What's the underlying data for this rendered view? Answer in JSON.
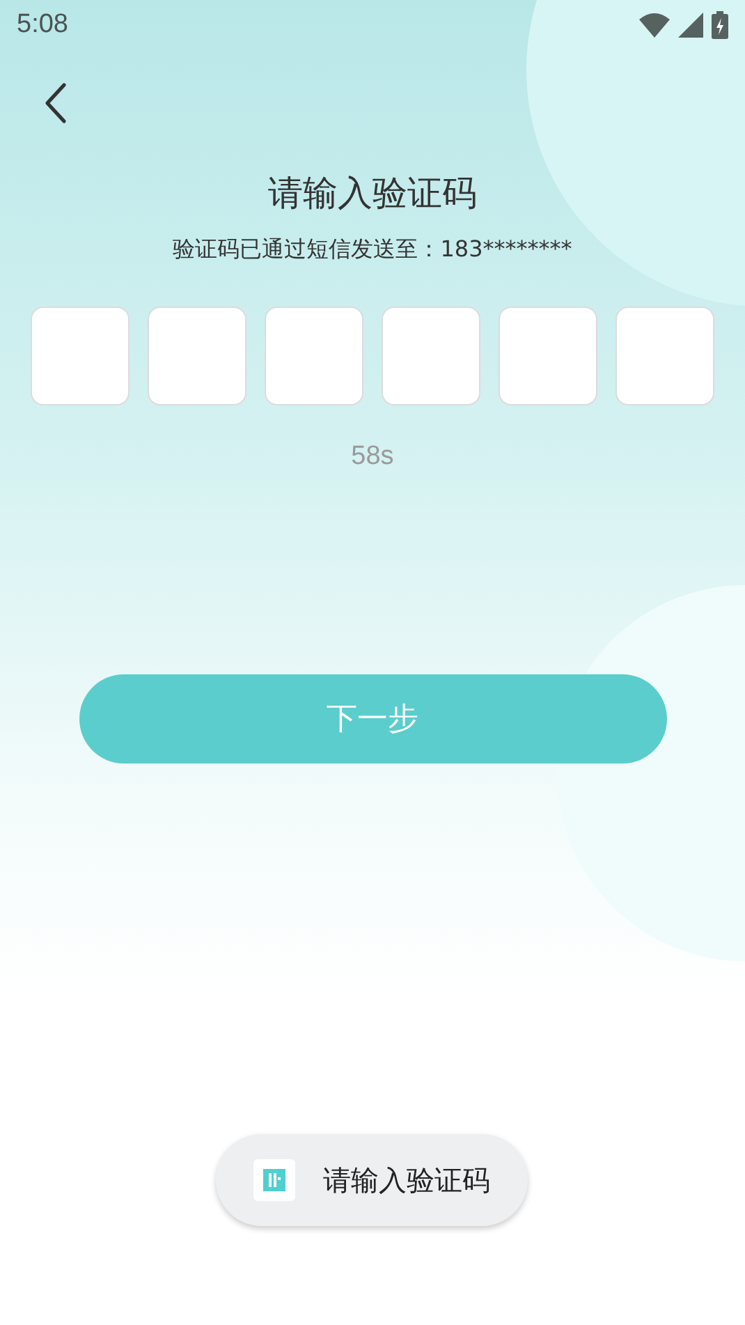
{
  "status_bar": {
    "time": "5:08"
  },
  "title": "请输入验证码",
  "subtitle": "验证码已通过短信发送至：183********",
  "code_fields": [
    {
      "kind": "box"
    },
    {
      "kind": "box"
    },
    {
      "kind": "box"
    },
    {
      "kind": "box"
    },
    {
      "kind": "box"
    },
    {
      "kind": "box"
    }
  ],
  "countdown": "58s",
  "next_button": "下一步",
  "toast": {
    "text": "请输入验证码"
  }
}
